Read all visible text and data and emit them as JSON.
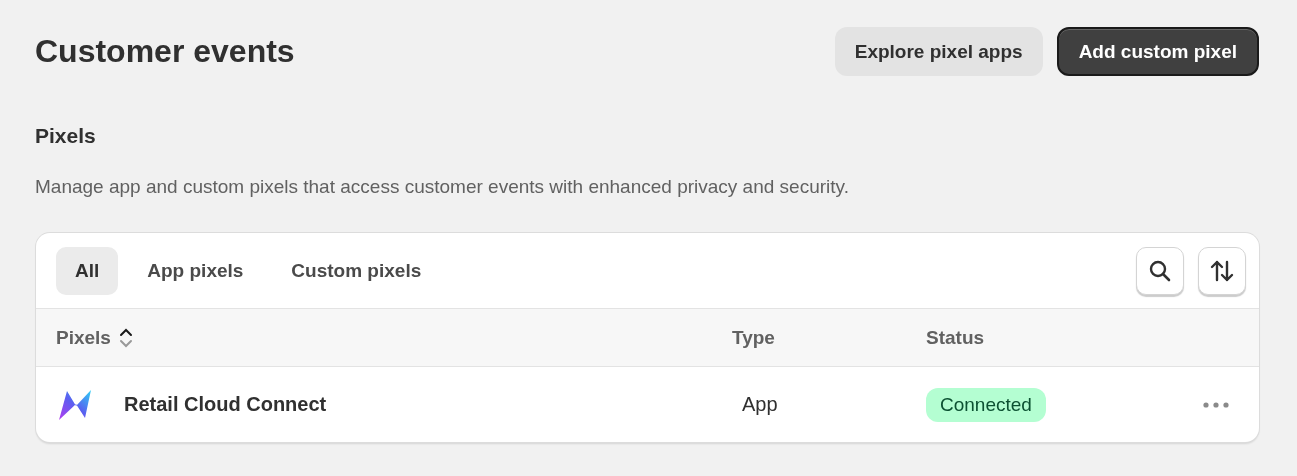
{
  "page": {
    "title": "Customer events",
    "actions": [
      {
        "label": "Explore pixel apps",
        "kind": "secondary"
      },
      {
        "label": "Add custom pixel",
        "kind": "primary"
      }
    ]
  },
  "section": {
    "heading": "Pixels",
    "description": "Manage app and custom pixels that access customer events with enhanced privacy and security."
  },
  "tabs": [
    {
      "label": "All",
      "selected": true
    },
    {
      "label": "App pixels",
      "selected": false
    },
    {
      "label": "Custom pixels",
      "selected": false
    }
  ],
  "table": {
    "columns": [
      {
        "label": "Pixels",
        "sortable": true
      },
      {
        "label": "Type",
        "sortable": false
      },
      {
        "label": "Status",
        "sortable": false
      }
    ],
    "rows": [
      {
        "name": "Retail Cloud Connect",
        "type": "App",
        "status": "Connected"
      }
    ]
  }
}
